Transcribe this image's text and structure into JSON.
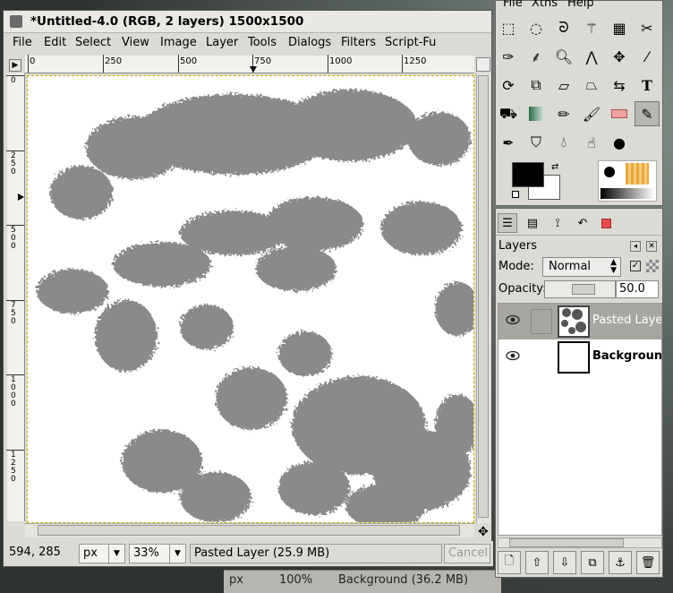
{
  "image_window": {
    "title": "*Untitled-4.0 (RGB, 2 layers) 1500x1500",
    "menu": [
      "File",
      "Edit",
      "Select",
      "View",
      "Image",
      "Layer",
      "Tools",
      "Dialogs",
      "Filters",
      "Script-Fu"
    ],
    "hruler_labels": [
      "0",
      "250",
      "500",
      "750",
      "1000",
      "1250"
    ],
    "vruler_labels": [
      "0",
      "250",
      "500",
      "750",
      "1000",
      "1250"
    ],
    "status": {
      "coords": "594, 285",
      "unit": "px",
      "zoom": "33%",
      "message": "Pasted Layer (25.9 MB)",
      "cancel": "Cancel"
    }
  },
  "toolbox": {
    "menu": [
      "File",
      "Xtns",
      "Help"
    ],
    "fg_color": "#000000",
    "bg_color": "#ffffff"
  },
  "layers_dock": {
    "title": "Layers",
    "mode_label": "Mode:",
    "mode_value": "Normal",
    "opacity_label": "Opacity:",
    "opacity_value": "50.0",
    "layers": [
      {
        "name": "Pasted Layer",
        "selected": true
      },
      {
        "name": "Background",
        "selected": false
      }
    ]
  },
  "behind": {
    "unit": "px",
    "zoom": "100%",
    "message": "Background (36.2 MB)"
  },
  "colors": {
    "fractal": "#8a8a8a",
    "selection": "#d1b900"
  }
}
